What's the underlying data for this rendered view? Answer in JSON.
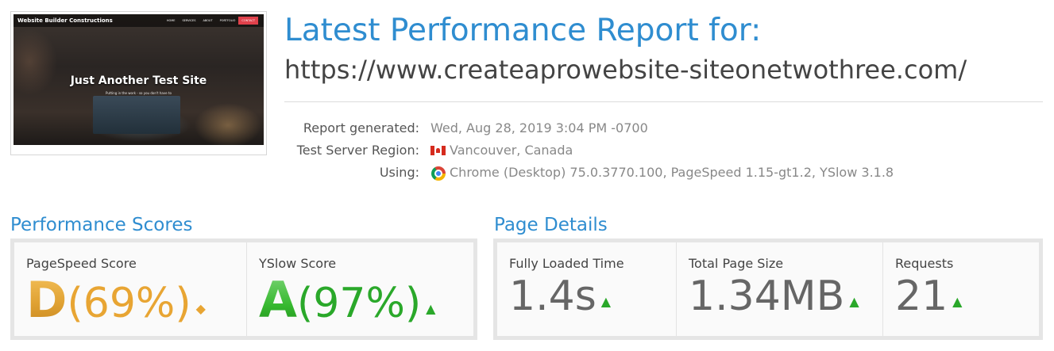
{
  "thumbnail": {
    "brand": "Website Builder Constructions",
    "nav_links": [
      "HOME",
      "SERVICES",
      "ABOUT",
      "PORTFOLIO",
      "CLIENTS"
    ],
    "contact_label": "CONTACT",
    "hero_title": "Just Another Test Site",
    "hero_subtitle": "Putting in the work - so you don't have to"
  },
  "header": {
    "title": "Latest Performance Report for:",
    "url": "https://www.createaprowebsite-siteonetwothree.com/"
  },
  "meta": {
    "report_generated_label": "Report generated:",
    "report_generated_value": "Wed, Aug 28, 2019 3:04 PM -0700",
    "region_label": "Test Server Region:",
    "region_value": "Vancouver, Canada",
    "region_icon": "canada-flag-icon",
    "using_label": "Using:",
    "using_value": "Chrome (Desktop) 75.0.3770.100, PageSpeed 1.15-gt1.2, YSlow 3.1.8",
    "using_icon": "chrome-icon"
  },
  "performance": {
    "title": "Performance Scores",
    "pagespeed": {
      "label": "PageSpeed Score",
      "grade": "D",
      "percent": "(69%)",
      "trend_icon": "diamond-icon",
      "color": "#e8a533"
    },
    "yslow": {
      "label": "YSlow Score",
      "grade": "A",
      "percent": "(97%)",
      "trend_icon": "up-arrow-icon",
      "color": "#2aa82a"
    }
  },
  "details": {
    "title": "Page Details",
    "loaded": {
      "label": "Fully Loaded Time",
      "value": "1.4s",
      "trend_icon": "up-arrow-icon"
    },
    "size": {
      "label": "Total Page Size",
      "value": "1.34MB",
      "trend_icon": "up-arrow-icon"
    },
    "requests": {
      "label": "Requests",
      "value": "21",
      "trend_icon": "up-arrow-icon"
    }
  }
}
